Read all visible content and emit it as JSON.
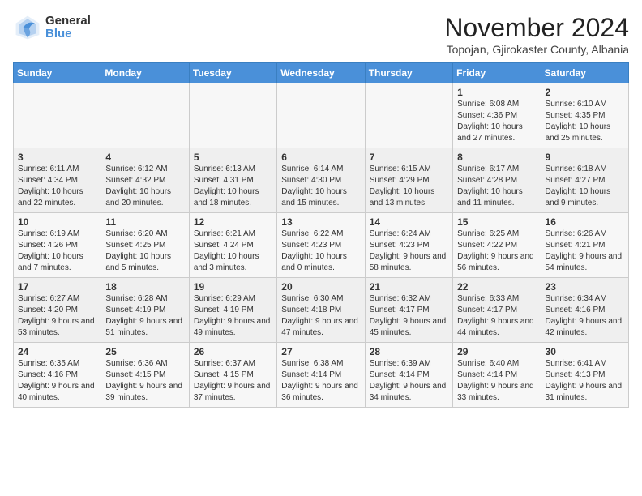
{
  "logo": {
    "general": "General",
    "blue": "Blue"
  },
  "title": "November 2024",
  "location": "Topojan, Gjirokaster County, Albania",
  "weekdays": [
    "Sunday",
    "Monday",
    "Tuesday",
    "Wednesday",
    "Thursday",
    "Friday",
    "Saturday"
  ],
  "weeks": [
    [
      {
        "day": "",
        "info": ""
      },
      {
        "day": "",
        "info": ""
      },
      {
        "day": "",
        "info": ""
      },
      {
        "day": "",
        "info": ""
      },
      {
        "day": "",
        "info": ""
      },
      {
        "day": "1",
        "info": "Sunrise: 6:08 AM\nSunset: 4:36 PM\nDaylight: 10 hours and 27 minutes."
      },
      {
        "day": "2",
        "info": "Sunrise: 6:10 AM\nSunset: 4:35 PM\nDaylight: 10 hours and 25 minutes."
      }
    ],
    [
      {
        "day": "3",
        "info": "Sunrise: 6:11 AM\nSunset: 4:34 PM\nDaylight: 10 hours and 22 minutes."
      },
      {
        "day": "4",
        "info": "Sunrise: 6:12 AM\nSunset: 4:32 PM\nDaylight: 10 hours and 20 minutes."
      },
      {
        "day": "5",
        "info": "Sunrise: 6:13 AM\nSunset: 4:31 PM\nDaylight: 10 hours and 18 minutes."
      },
      {
        "day": "6",
        "info": "Sunrise: 6:14 AM\nSunset: 4:30 PM\nDaylight: 10 hours and 15 minutes."
      },
      {
        "day": "7",
        "info": "Sunrise: 6:15 AM\nSunset: 4:29 PM\nDaylight: 10 hours and 13 minutes."
      },
      {
        "day": "8",
        "info": "Sunrise: 6:17 AM\nSunset: 4:28 PM\nDaylight: 10 hours and 11 minutes."
      },
      {
        "day": "9",
        "info": "Sunrise: 6:18 AM\nSunset: 4:27 PM\nDaylight: 10 hours and 9 minutes."
      }
    ],
    [
      {
        "day": "10",
        "info": "Sunrise: 6:19 AM\nSunset: 4:26 PM\nDaylight: 10 hours and 7 minutes."
      },
      {
        "day": "11",
        "info": "Sunrise: 6:20 AM\nSunset: 4:25 PM\nDaylight: 10 hours and 5 minutes."
      },
      {
        "day": "12",
        "info": "Sunrise: 6:21 AM\nSunset: 4:24 PM\nDaylight: 10 hours and 3 minutes."
      },
      {
        "day": "13",
        "info": "Sunrise: 6:22 AM\nSunset: 4:23 PM\nDaylight: 10 hours and 0 minutes."
      },
      {
        "day": "14",
        "info": "Sunrise: 6:24 AM\nSunset: 4:23 PM\nDaylight: 9 hours and 58 minutes."
      },
      {
        "day": "15",
        "info": "Sunrise: 6:25 AM\nSunset: 4:22 PM\nDaylight: 9 hours and 56 minutes."
      },
      {
        "day": "16",
        "info": "Sunrise: 6:26 AM\nSunset: 4:21 PM\nDaylight: 9 hours and 54 minutes."
      }
    ],
    [
      {
        "day": "17",
        "info": "Sunrise: 6:27 AM\nSunset: 4:20 PM\nDaylight: 9 hours and 53 minutes."
      },
      {
        "day": "18",
        "info": "Sunrise: 6:28 AM\nSunset: 4:19 PM\nDaylight: 9 hours and 51 minutes."
      },
      {
        "day": "19",
        "info": "Sunrise: 6:29 AM\nSunset: 4:19 PM\nDaylight: 9 hours and 49 minutes."
      },
      {
        "day": "20",
        "info": "Sunrise: 6:30 AM\nSunset: 4:18 PM\nDaylight: 9 hours and 47 minutes."
      },
      {
        "day": "21",
        "info": "Sunrise: 6:32 AM\nSunset: 4:17 PM\nDaylight: 9 hours and 45 minutes."
      },
      {
        "day": "22",
        "info": "Sunrise: 6:33 AM\nSunset: 4:17 PM\nDaylight: 9 hours and 44 minutes."
      },
      {
        "day": "23",
        "info": "Sunrise: 6:34 AM\nSunset: 4:16 PM\nDaylight: 9 hours and 42 minutes."
      }
    ],
    [
      {
        "day": "24",
        "info": "Sunrise: 6:35 AM\nSunset: 4:16 PM\nDaylight: 9 hours and 40 minutes."
      },
      {
        "day": "25",
        "info": "Sunrise: 6:36 AM\nSunset: 4:15 PM\nDaylight: 9 hours and 39 minutes."
      },
      {
        "day": "26",
        "info": "Sunrise: 6:37 AM\nSunset: 4:15 PM\nDaylight: 9 hours and 37 minutes."
      },
      {
        "day": "27",
        "info": "Sunrise: 6:38 AM\nSunset: 4:14 PM\nDaylight: 9 hours and 36 minutes."
      },
      {
        "day": "28",
        "info": "Sunrise: 6:39 AM\nSunset: 4:14 PM\nDaylight: 9 hours and 34 minutes."
      },
      {
        "day": "29",
        "info": "Sunrise: 6:40 AM\nSunset: 4:14 PM\nDaylight: 9 hours and 33 minutes."
      },
      {
        "day": "30",
        "info": "Sunrise: 6:41 AM\nSunset: 4:13 PM\nDaylight: 9 hours and 31 minutes."
      }
    ]
  ]
}
